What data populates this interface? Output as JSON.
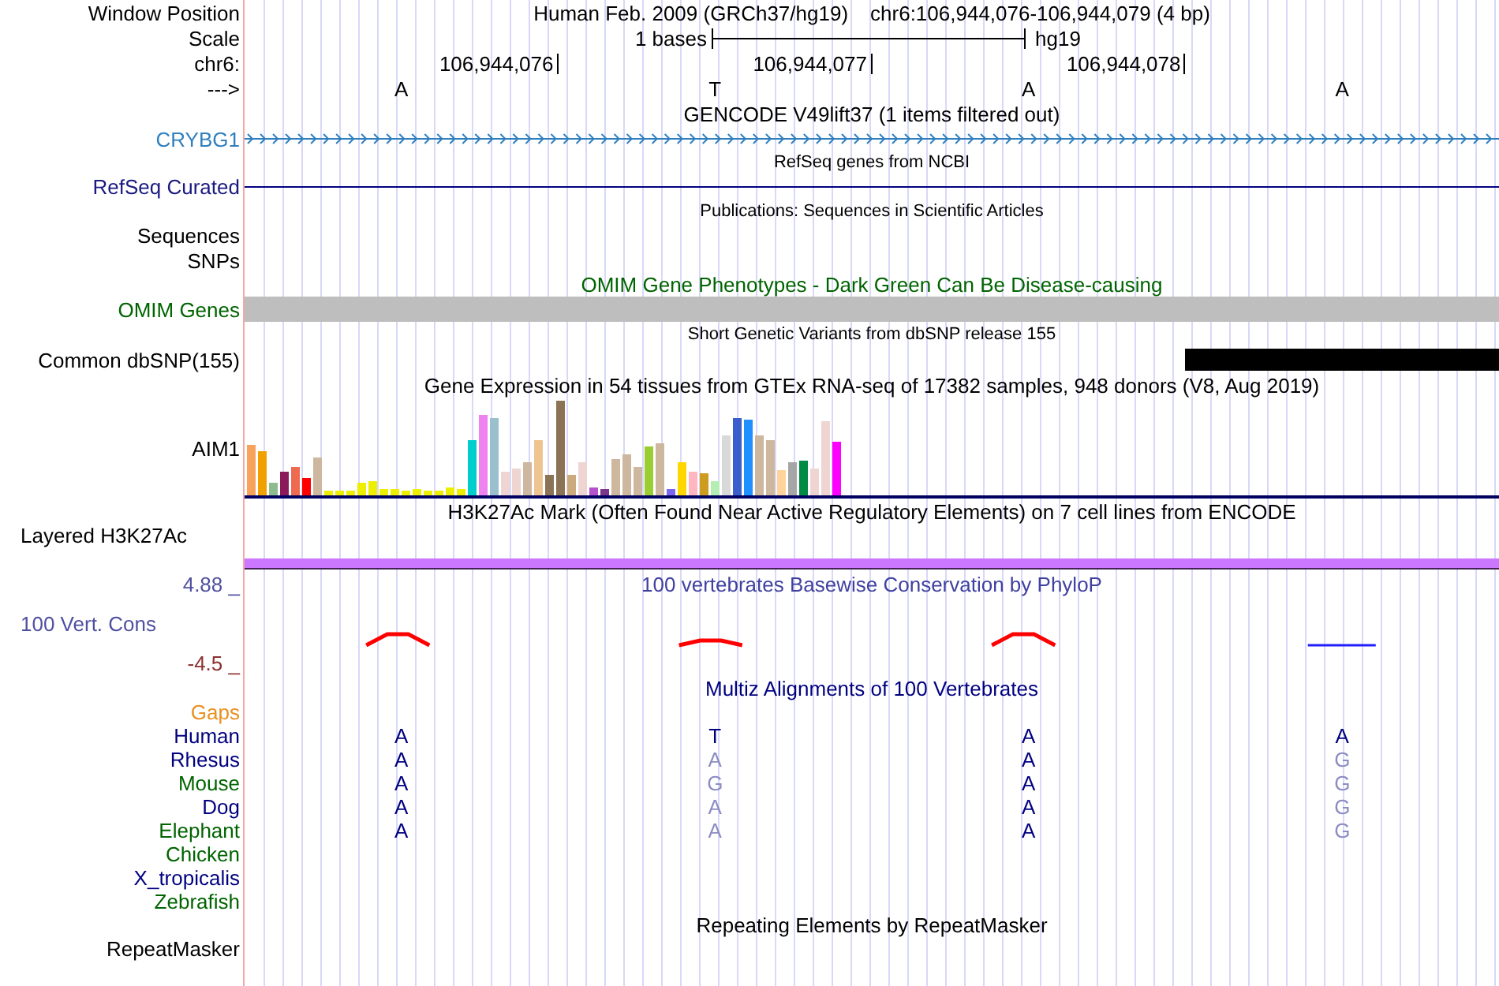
{
  "header": {
    "position_label": "Window Position",
    "assembly_text": "Human Feb. 2009 (GRCh37/hg19)",
    "position_text": "chr6:106,944,076-106,944,079 (4 bp)",
    "scale_label": "Scale",
    "scale_text": "1 bases",
    "assembly": "hg19",
    "chrom_label": "chr6:",
    "ticks": [
      "106,944,076",
      "106,944,077",
      "106,944,078"
    ],
    "strand_label": "--->",
    "bases": [
      "A",
      "T",
      "A",
      "A"
    ]
  },
  "gencode": {
    "title": "GENCODE V49lift37 (1 items filtered out)",
    "label": "CRYBG1"
  },
  "refseq": {
    "title": "RefSeq genes from NCBI",
    "label": "RefSeq Curated"
  },
  "publications": {
    "title": "Publications: Sequences in Scientific Articles",
    "labels": [
      "Sequences",
      "SNPs"
    ]
  },
  "omim": {
    "title": "OMIM Gene Phenotypes - Dark Green Can Be Disease-causing",
    "label": "OMIM Genes"
  },
  "dbsnp": {
    "title": "Short Genetic Variants from dbSNP release 155",
    "label": "Common dbSNP(155)"
  },
  "gtex": {
    "title": "Gene Expression in 54 tissues from GTEx RNA-seq of 17382 samples, 948 donors (V8, Aug 2019)",
    "label": "AIM1"
  },
  "h3k27ac": {
    "title": "H3K27Ac Mark (Often Found Near Active Regulatory Elements) on 7 cell lines from ENCODE",
    "label": "Layered H3K27Ac"
  },
  "conservation": {
    "title": "100 vertebrates Basewise Conservation by PhyloP",
    "label": "100 Vert. Cons",
    "max": "4.88 _",
    "min": "-4.5 _"
  },
  "multiz": {
    "title": "Multiz Alignments of 100 Vertebrates",
    "gaps_label": "Gaps",
    "species": [
      {
        "name": "Human",
        "color": "#000080",
        "bases": [
          {
            "base": "A",
            "match": true
          },
          {
            "base": "T",
            "match": true
          },
          {
            "base": "A",
            "match": true
          },
          {
            "base": "A",
            "match": true
          }
        ]
      },
      {
        "name": "Rhesus",
        "color": "#000080",
        "bases": [
          {
            "base": "A",
            "match": true
          },
          {
            "base": "A",
            "match": false
          },
          {
            "base": "A",
            "match": true
          },
          {
            "base": "G",
            "match": false
          }
        ]
      },
      {
        "name": "Mouse",
        "color": "#006400",
        "bases": [
          {
            "base": "A",
            "match": true
          },
          {
            "base": "G",
            "match": false
          },
          {
            "base": "A",
            "match": true
          },
          {
            "base": "G",
            "match": false
          }
        ]
      },
      {
        "name": "Dog",
        "color": "#000080",
        "bases": [
          {
            "base": "A",
            "match": true
          },
          {
            "base": "A",
            "match": false
          },
          {
            "base": "A",
            "match": true
          },
          {
            "base": "G",
            "match": false
          }
        ]
      },
      {
        "name": "Elephant",
        "color": "#006400",
        "bases": [
          {
            "base": "A",
            "match": true
          },
          {
            "base": "A",
            "match": false
          },
          {
            "base": "A",
            "match": true
          },
          {
            "base": "G",
            "match": false
          }
        ]
      },
      {
        "name": "Chicken",
        "color": "#006400"
      },
      {
        "name": "X_tropicalis",
        "color": "#000080"
      },
      {
        "name": "Zebrafish",
        "color": "#006400"
      }
    ]
  },
  "repeatmasker": {
    "title": "Repeating Elements by RepeatMasker",
    "label": "RepeatMasker"
  }
}
